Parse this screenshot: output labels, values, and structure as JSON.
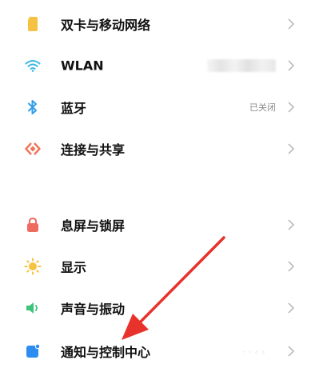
{
  "settings": {
    "items": [
      {
        "label": "双卡与移动网络",
        "icon": "sim-card-icon",
        "value": ""
      },
      {
        "label": "WLAN",
        "icon": "wifi-icon",
        "value": ""
      },
      {
        "label": "蓝牙",
        "icon": "bluetooth-icon",
        "value": "已关闭"
      },
      {
        "label": "连接与共享",
        "icon": "connection-share-icon",
        "value": ""
      },
      {
        "label": "息屏与锁屏",
        "icon": "lock-icon",
        "value": ""
      },
      {
        "label": "显示",
        "icon": "brightness-icon",
        "value": ""
      },
      {
        "label": "声音与振动",
        "icon": "speaker-icon",
        "value": ""
      },
      {
        "label": "通知与控制中心",
        "icon": "notification-icon",
        "value": ""
      }
    ]
  },
  "colors": {
    "sim": "#f5c242",
    "wifi": "#3ab6e8",
    "bluetooth": "#2f9de8",
    "connection": "#f0735a",
    "lock": "#ee6b5f",
    "display": "#f7c23f",
    "sound": "#3bc47a",
    "notification": "#2d8cf0",
    "arrow": "#e8322c"
  }
}
